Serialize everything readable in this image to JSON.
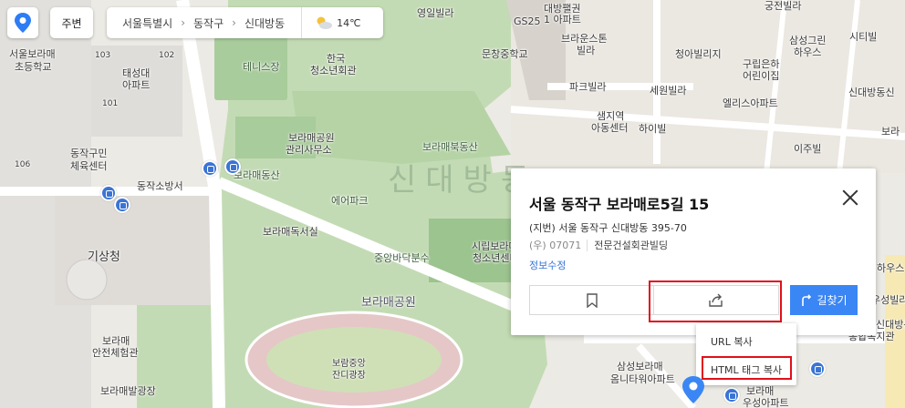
{
  "top": {
    "nearby_label": "주변",
    "breadcrumbs": [
      "서울특별시",
      "동작구",
      "신대방동"
    ],
    "weather": {
      "icon": "partly-cloudy-icon",
      "temp": "14℃"
    }
  },
  "map": {
    "area_name": "신대방동",
    "labels": [
      "영일빌라",
      "대방팰권",
      "1 아파트",
      "GS25",
      "궁전빌라",
      "문창중학교",
      "브라운스톤",
      "빌라",
      "삼성그린",
      "하우스",
      "시티빌",
      "청아빌리지",
      "구립은하",
      "어린이집",
      "파크빌라",
      "세원빌라",
      "엘리스아파트",
      "신대방동신",
      "샘지역",
      "아동센터",
      "하이빌",
      "이주빌",
      "보라",
      "서울보라매",
      "초등학교",
      "103",
      "102",
      "태성대",
      "아파트",
      "101",
      "테니스장",
      "한국",
      "청소년회관",
      "보라매공원",
      "관리사무소",
      "보라매북동산",
      "106",
      "동작구민",
      "체육센터",
      "동작소방서",
      "보라매동산",
      "에어파크",
      "보라매독서실",
      "시립보라매",
      "청소년센터",
      "중앙바닥분수",
      "기상청",
      "보라매공원",
      "보라매",
      "안전체험관",
      "보람중앙",
      "잔디광장",
      "보라매발광장",
      "삼성보라매",
      "옴니타워아파트",
      "보라매",
      "우성아파트",
      "하우스",
      "우성빌라",
      "신대방동",
      "종합복지관"
    ]
  },
  "place": {
    "title": "서울 동작구 보라매로5길 15",
    "jibun": "(지번) 서울 동작구 신대방동 395-70",
    "postcode": "(우) 07071",
    "building": "전문건설회관빌딩",
    "edit_link": "정보수정",
    "route_label": "길찾기"
  },
  "share_menu": {
    "items": [
      "URL 복사",
      "HTML 태그 복사"
    ]
  },
  "colors": {
    "accent": "#3a86f5",
    "highlight": "#e0101a",
    "park": "#c3dbb4"
  }
}
